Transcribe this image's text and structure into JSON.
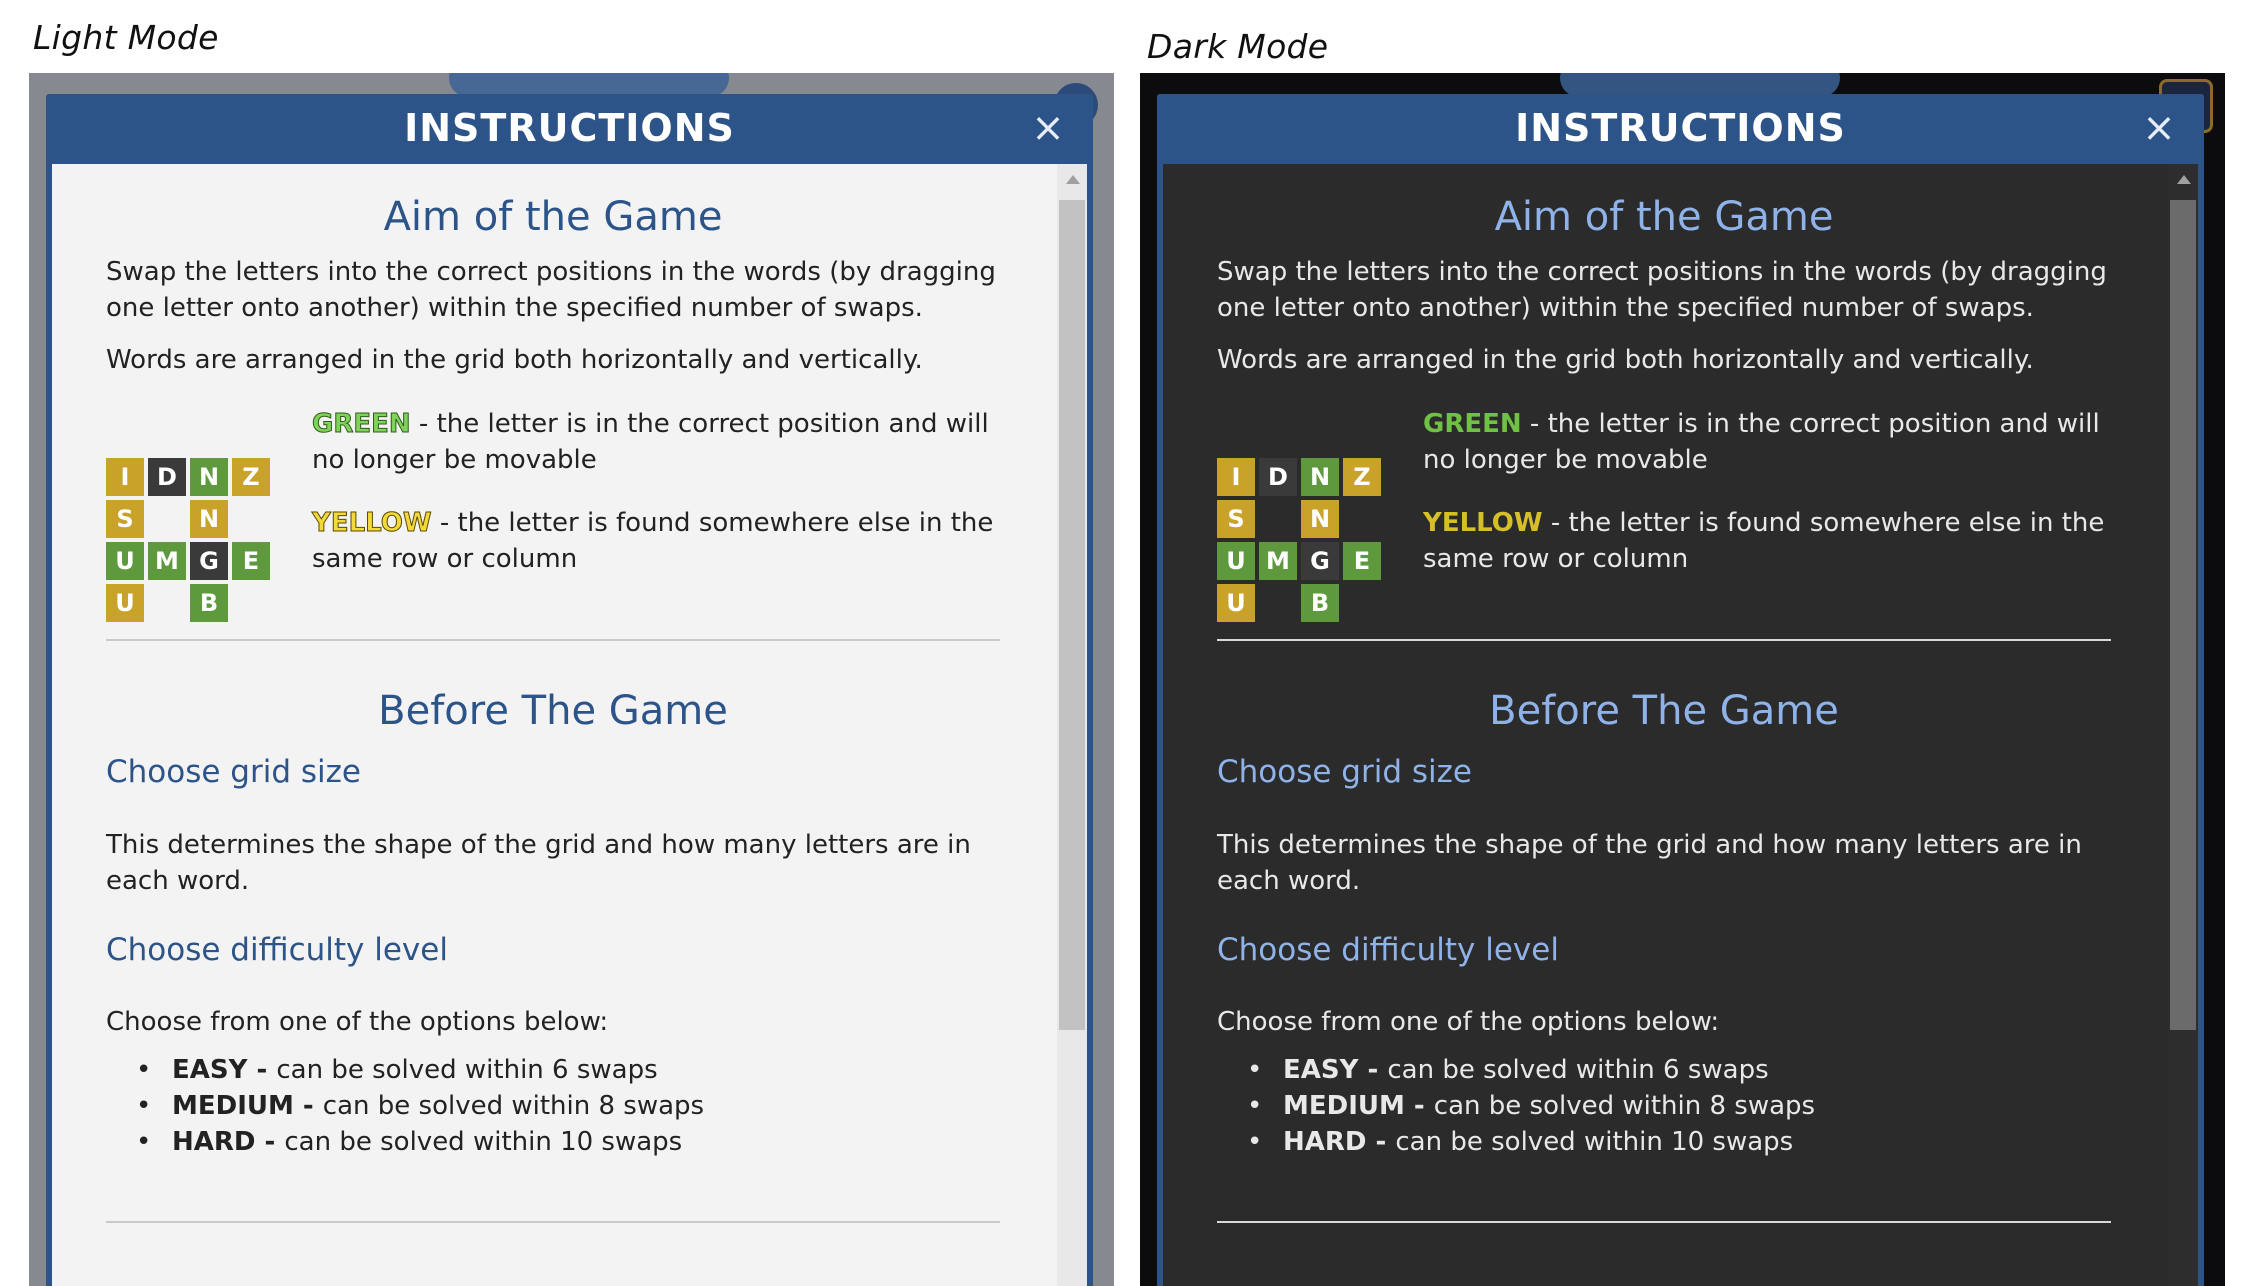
{
  "captions": {
    "light": "Light Mode",
    "dark": "Dark Mode"
  },
  "modal": {
    "title": "INSTRUCTIONS",
    "close_glyph": "×",
    "aim": {
      "heading": "Aim of the Game",
      "para1": "Swap the letters into the correct positions in the words (by dragging one letter onto another) within the specified number of swaps.",
      "para2": "Words are arranged in the grid both horizontally and vertically.",
      "green_label": "GREEN",
      "green_sep": " - ",
      "green_text": "the letter is in the correct position and will no longer be movable",
      "yellow_label": "YELLOW",
      "yellow_sep": " - ",
      "yellow_text": "the letter is found somewhere else in the same row or column"
    },
    "example_grid": [
      {
        "letter": "I",
        "color": "yellow"
      },
      {
        "letter": "D",
        "color": "gray"
      },
      {
        "letter": "N",
        "color": "green"
      },
      {
        "letter": "Z",
        "color": "yellow"
      },
      {
        "letter": "S",
        "color": "yellow"
      },
      {
        "letter": "N",
        "color": "yellow"
      },
      {
        "letter": "U",
        "color": "green"
      },
      {
        "letter": "M",
        "color": "green"
      },
      {
        "letter": "G",
        "color": "gray"
      },
      {
        "letter": "E",
        "color": "green"
      },
      {
        "letter": "U",
        "color": "yellow"
      },
      {
        "letter": "B",
        "color": "green"
      }
    ],
    "before": {
      "heading": "Before The Game",
      "grid_size_heading": "Choose grid size",
      "grid_size_text": "This determines the shape of the grid and how many letters are in each word.",
      "difficulty_heading": "Choose difficulty level",
      "difficulty_intro": "Choose from one of the options below:",
      "options": [
        {
          "level": "EASY",
          "sep": " - ",
          "desc": "can be solved within 6 swaps"
        },
        {
          "level": "MEDIUM",
          "sep": " - ",
          "desc": "can be solved within 8 swaps"
        },
        {
          "level": "HARD",
          "sep": " - ",
          "desc": "can be solved within 10 swaps"
        }
      ]
    }
  },
  "colors": {
    "header_blue": "#2c5489",
    "tile_yellow": "#c9a22a",
    "tile_green": "#5e9a3d",
    "tile_gray": "#3a3a3a",
    "light_body": "#f3f3f3",
    "dark_body": "#2b2b2b"
  },
  "icons": {
    "close": "close-icon",
    "scroll_up": "scroll-up-arrow-icon"
  }
}
